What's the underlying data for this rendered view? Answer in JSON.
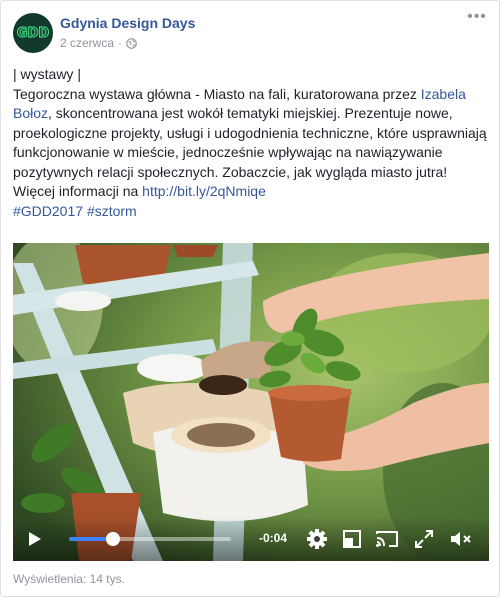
{
  "post": {
    "page_name": "Gdynia Design Days",
    "avatar_text": "GDD",
    "date": "2 czerwca",
    "separator": "·",
    "text_prefix": "| wystawy |",
    "text_body_1": "Tegoroczna wystawa główna - Miasto na fali, kuratorowana przez ",
    "mention": "Izabela Bołoz",
    "text_body_2": ", skoncentrowana jest wokół tematyki miejskiej. Prezentuje nowe, proekologiczne projekty, usługi i udogodnienia techniczne, które usprawniają funkcjonowanie w mieście, jednocześnie wpływając na nawiązywanie pozytywnych relacji społecznych. Zobaczcie, jak wygląda miasto jutra!",
    "more_info_label": "Więcej informacji na ",
    "more_info_link": "http://bit.ly/2qNmiqe",
    "hashtag_1": "#GDD2017",
    "hashtag_2": "#sztorm"
  },
  "video": {
    "time_remaining": "-0:04",
    "progress": 0.27,
    "icons": {
      "play": "play-icon",
      "settings": "gear-icon",
      "popout": "popout-icon",
      "cast": "cast-icon",
      "fullscreen": "expand-icon",
      "mute": "muted-speaker-icon"
    }
  },
  "footer": {
    "views": "Wyświetlenia: 14 tys."
  },
  "colors": {
    "link": "#365899",
    "meta": "#90949c",
    "progress_fill": "#4080ff"
  }
}
